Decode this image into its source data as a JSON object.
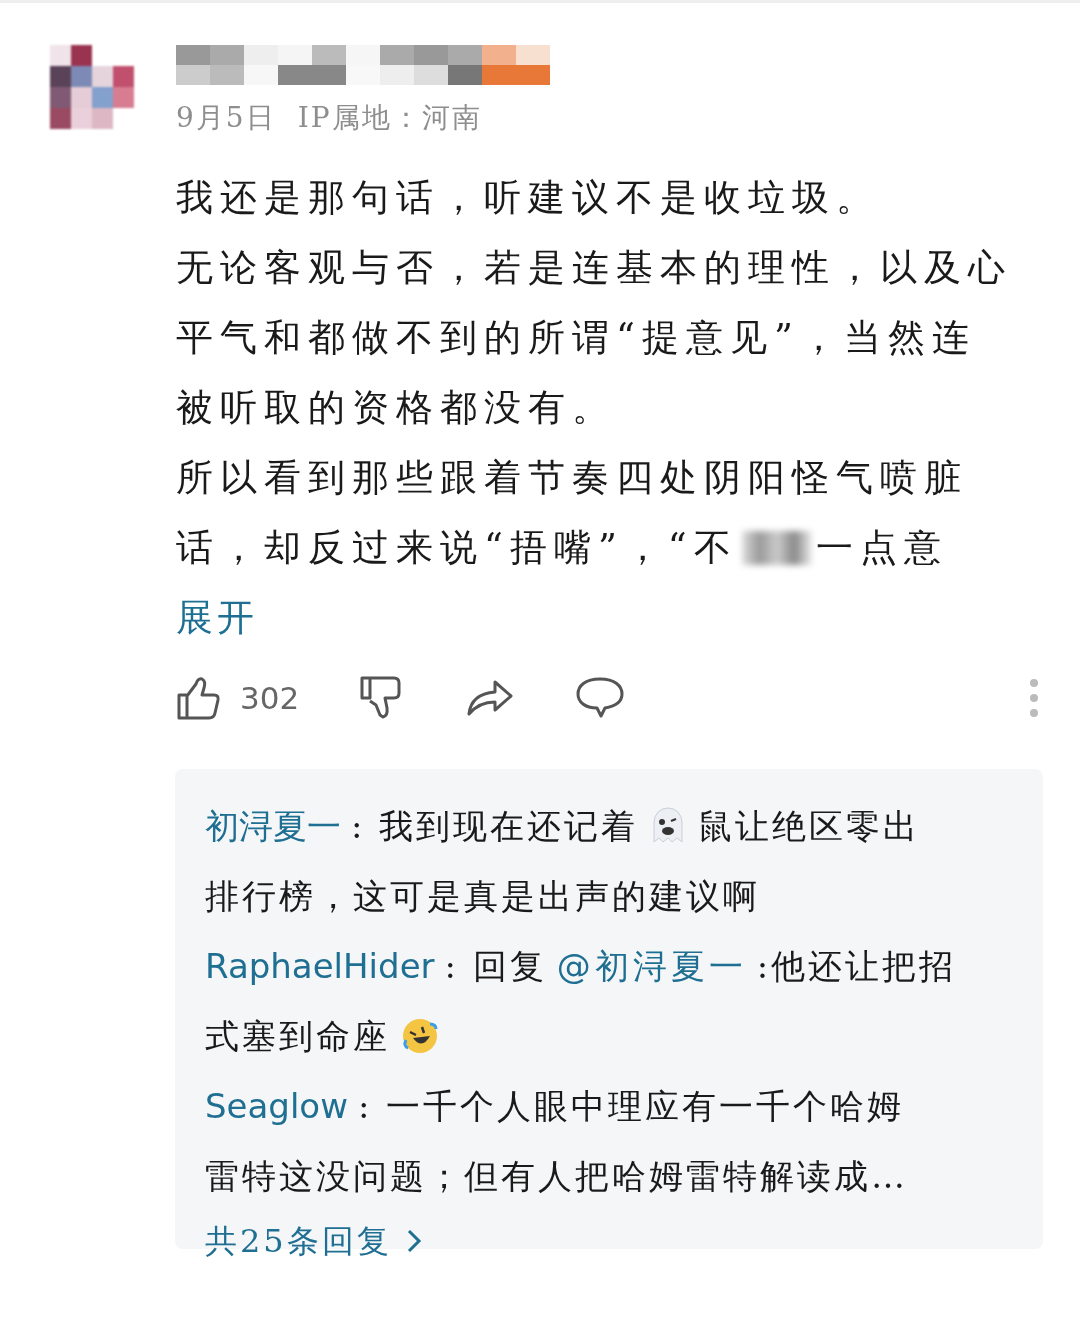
{
  "comment": {
    "date": "9月5日",
    "ip_location": "IP属地：河南",
    "lines": [
      {
        "text": "我还是那句话，听建议不是收垃圾。",
        "redacted": false
      },
      {
        "text": "无论客观与否，若是连基本的理性，以及心",
        "redacted": false
      },
      {
        "text": "平气和都做不到的所谓“提意见”，当然连",
        "redacted": false
      },
      {
        "text": "被听取的资格都没有。",
        "redacted": false
      },
      {
        "text": "所以看到那些跟着节奏四处阴阳怪气喷脏",
        "redacted": false
      },
      {
        "text": "话，却反过来说“捂嘴”，“不",
        "redacted": true,
        "after": "一点意"
      }
    ],
    "expand": "展开",
    "likes": "302"
  },
  "replies": [
    {
      "author": "初浔夏一",
      "lines": [
        [
          {
            "kind": "text",
            "text": ": 我到现在还记着"
          },
          {
            "kind": "ghost-emoji"
          },
          {
            "kind": "text",
            "text": "鼠让绝区零出"
          }
        ],
        [
          {
            "kind": "text",
            "text": "排行榜，这可是真是出声的建议啊"
          }
        ]
      ]
    },
    {
      "author": "RaphaelHider",
      "lines": [
        [
          {
            "kind": "text",
            "text": ": 回复"
          },
          {
            "kind": "mention",
            "text": "@初浔夏一"
          },
          {
            "kind": "text",
            "text": ":他还让把招"
          }
        ],
        [
          {
            "kind": "text",
            "text": "式塞到命座"
          },
          {
            "kind": "laugh-emoji"
          }
        ]
      ]
    },
    {
      "author": "Seaglow",
      "lines": [
        [
          {
            "kind": "text",
            "text": ": 一千个人眼中理应有一千个哈姆"
          }
        ],
        [
          {
            "kind": "text",
            "text": "雷特这没问题；但有人把哈姆雷特解读成…"
          }
        ]
      ]
    }
  ],
  "more_replies": "共25条回复"
}
